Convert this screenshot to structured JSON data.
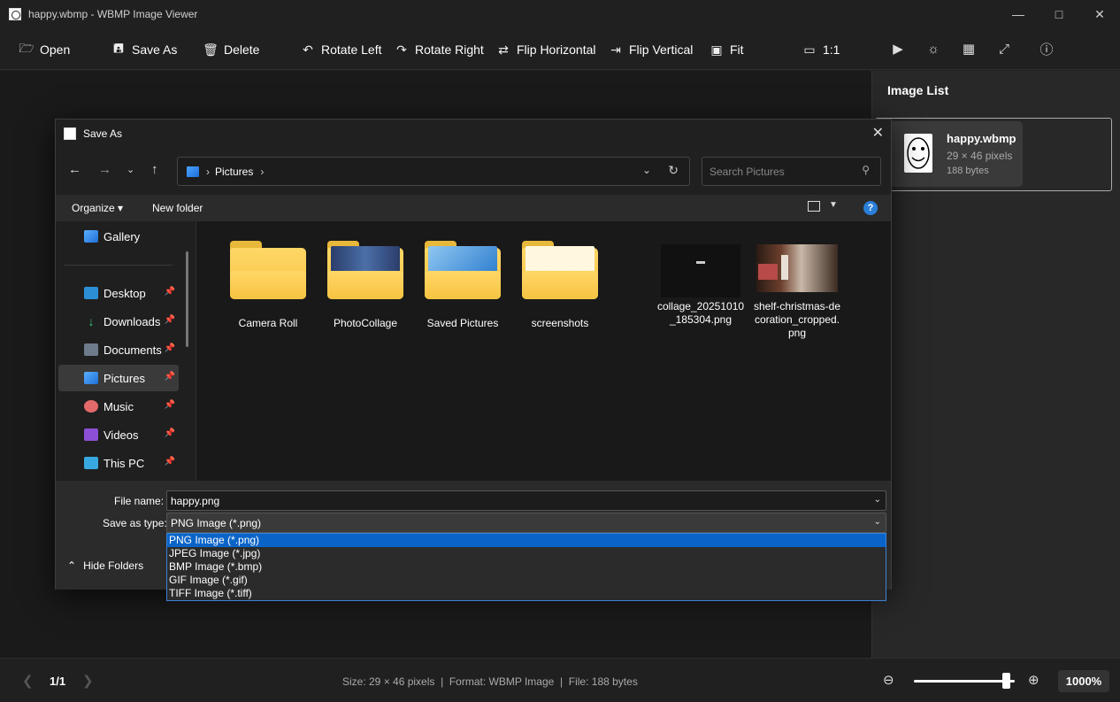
{
  "window": {
    "title": "happy.wbmp - WBMP Image Viewer"
  },
  "toolbar": {
    "open": "Open",
    "save_as": "Save As",
    "delete": "Delete",
    "rotate_left": "Rotate Left",
    "rotate_right": "Rotate Right",
    "flip_horizontal": "Flip Horizontal",
    "flip_vertical": "Flip Vertical",
    "fit": "Fit",
    "actual_size": "1:1"
  },
  "image_list": {
    "header": "Image List",
    "items": [
      {
        "name": "happy.wbmp",
        "dims": "29 × 46 pixels",
        "size": "188 bytes"
      }
    ]
  },
  "status": {
    "page": "1/1",
    "info": "Size: 29 × 46 pixels  |  Format: WBMP Image  |  File: 188 bytes",
    "zoom": "1000%",
    "zoom_level_fraction": 0.92
  },
  "dialog": {
    "title": "Save As",
    "breadcrumb": "Pictures",
    "search_placeholder": "Search Pictures",
    "organize": "Organize",
    "new_folder": "New folder",
    "nav_items": [
      {
        "label": "Gallery",
        "pinned": false
      },
      {
        "label": "Desktop",
        "pinned": true
      },
      {
        "label": "Downloads",
        "pinned": true
      },
      {
        "label": "Documents",
        "pinned": true
      },
      {
        "label": "Pictures",
        "pinned": true
      },
      {
        "label": "Music",
        "pinned": true
      },
      {
        "label": "Videos",
        "pinned": true
      },
      {
        "label": "This PC",
        "pinned": true
      }
    ],
    "files": [
      {
        "name": "Camera Roll",
        "kind": "folder"
      },
      {
        "name": "PhotoCollage",
        "kind": "folder"
      },
      {
        "name": "Saved Pictures",
        "kind": "folder"
      },
      {
        "name": "screenshots",
        "kind": "folder"
      },
      {
        "name": "collage_20251010_185304.png",
        "kind": "image"
      },
      {
        "name": "shelf-christmas-decoration_cropped.png",
        "kind": "image"
      }
    ],
    "file_name_label": "File name:",
    "file_name_value": "happy.png",
    "save_type_label": "Save as type:",
    "save_type_value": "PNG Image (*.png)",
    "type_options": [
      "PNG Image (*.png)",
      "JPEG Image (*.jpg)",
      "BMP Image (*.bmp)",
      "GIF Image (*.gif)",
      "TIFF Image (*.tiff)"
    ],
    "hide_folders": "Hide Folders"
  }
}
